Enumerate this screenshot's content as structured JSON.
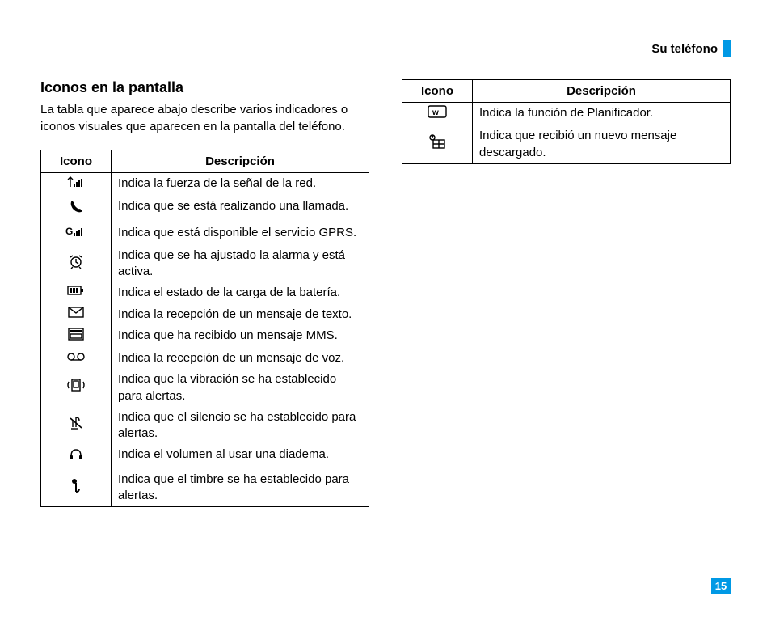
{
  "header": {
    "section_label": "Su teléfono"
  },
  "page_number": "15",
  "left": {
    "heading": "Iconos en la pantalla",
    "intro": "La tabla que aparece abajo describe varios indicadores o iconos visuales que aparecen en la pantalla del teléfono.",
    "table": {
      "head_icon": "Icono",
      "head_desc": "Descripción",
      "rows": [
        {
          "icon": "signal",
          "desc": "Indica la fuerza de la señal de la red."
        },
        {
          "icon": "call",
          "desc": "Indica que se está realizando una llamada."
        },
        {
          "icon": "gprs",
          "desc": "Indica que está disponible el servicio GPRS."
        },
        {
          "icon": "alarm",
          "desc": "Indica que se ha ajustado la alarma y está activa."
        },
        {
          "icon": "battery",
          "desc": "Indica el estado de la carga de la batería."
        },
        {
          "icon": "sms",
          "desc": "Indica la recepción de un mensaje de texto."
        },
        {
          "icon": "mms",
          "desc": "Indica que ha recibido un mensaje MMS."
        },
        {
          "icon": "voicemail",
          "desc": "Indica la recepción de un mensaje de voz."
        },
        {
          "icon": "vibrate",
          "desc": "Indica que la vibración se ha establecido para alertas."
        },
        {
          "icon": "silent",
          "desc": "Indica que el silencio se ha establecido para alertas."
        },
        {
          "icon": "headset",
          "desc": "Indica el volumen al usar una diadema."
        },
        {
          "icon": "ringer",
          "desc": "Indica que el timbre se ha establecido para alertas."
        }
      ]
    }
  },
  "right": {
    "table": {
      "head_icon": "Icono",
      "head_desc": "Descripción",
      "rows": [
        {
          "icon": "planner",
          "desc": "Indica la función de Planificador."
        },
        {
          "icon": "download",
          "desc": "Indica que recibió un nuevo mensaje descargado."
        }
      ]
    }
  }
}
